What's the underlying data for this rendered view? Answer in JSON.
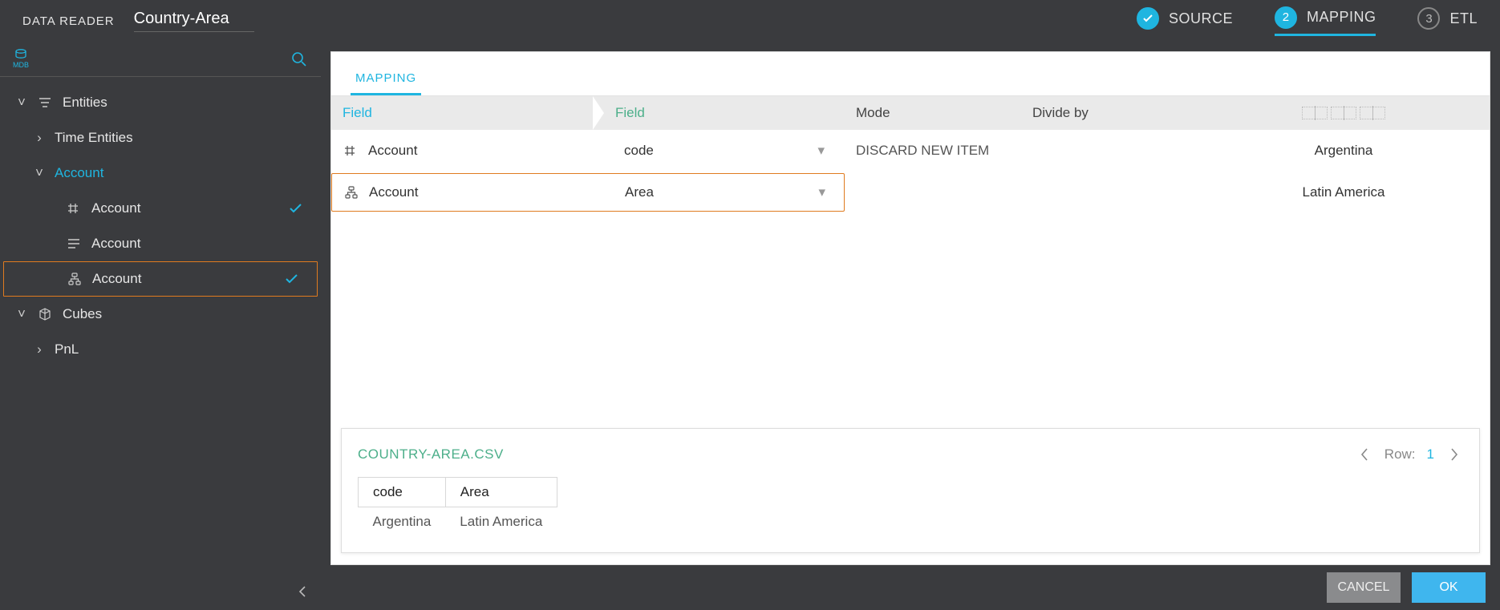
{
  "header": {
    "app_title": "DATA READER",
    "doc_name": "Country-Area",
    "steps": [
      {
        "label": "SOURCE",
        "badge": "✓",
        "state": "done"
      },
      {
        "label": "MAPPING",
        "badge": "2",
        "state": "active"
      },
      {
        "label": "ETL",
        "badge": "3",
        "state": "pending"
      }
    ]
  },
  "sidebar": {
    "mdb_label": "MDB",
    "tree": {
      "entities_label": "Entities",
      "time_entities_label": "Time Entities",
      "account_label": "Account",
      "account_children": [
        {
          "label": "Account",
          "icon": "hash",
          "checked": true,
          "selected": false
        },
        {
          "label": "Account",
          "icon": "lines",
          "checked": false,
          "selected": false
        },
        {
          "label": "Account",
          "icon": "hier",
          "checked": true,
          "selected": true
        }
      ],
      "cubes_label": "Cubes",
      "pnl_label": "PnL"
    }
  },
  "content": {
    "tabs": [
      {
        "label": "MAPPING",
        "active": true
      }
    ],
    "columns": {
      "source": "Field",
      "target": "Field",
      "mode": "Mode",
      "divide": "Divide by"
    },
    "rows": [
      {
        "icon": "hash",
        "source": "Account",
        "target": "code",
        "mode": "DISCARD NEW ITEM",
        "divide": "",
        "value": "Argentina",
        "highlight": false
      },
      {
        "icon": "hier",
        "source": "Account",
        "target": "Area",
        "mode": "",
        "divide": "",
        "value": "Latin America",
        "highlight": true
      }
    ]
  },
  "preview": {
    "title": "COUNTRY-AREA.CSV",
    "row_label": "Row:",
    "row_number": "1",
    "columns": [
      "code",
      "Area"
    ],
    "data": [
      [
        "Argentina",
        "Latin America"
      ]
    ]
  },
  "footer": {
    "cancel": "CANCEL",
    "ok": "OK"
  }
}
